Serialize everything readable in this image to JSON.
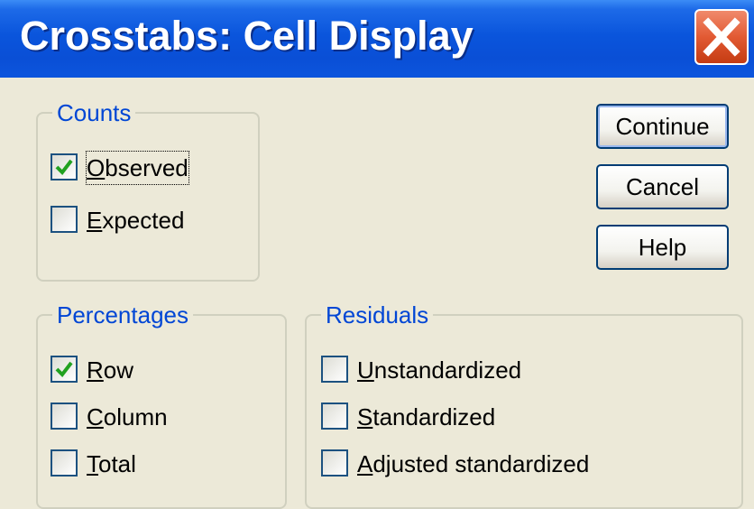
{
  "window": {
    "title": "Crosstabs: Cell Display"
  },
  "counts": {
    "legend": "Counts",
    "items": [
      {
        "label": "Observed",
        "mnemonic": "O",
        "rest": "bserved",
        "checked": true,
        "focused": true
      },
      {
        "label": "Expected",
        "mnemonic": "E",
        "rest": "xpected",
        "checked": false
      }
    ]
  },
  "buttons": {
    "continue": "Continue",
    "cancel": "Cancel",
    "help": "Help"
  },
  "percentages": {
    "legend": "Percentages",
    "items": [
      {
        "label": "Row",
        "mnemonic": "R",
        "rest": "ow",
        "checked": true
      },
      {
        "label": "Column",
        "mnemonic": "C",
        "rest": "olumn",
        "checked": false
      },
      {
        "label": "Total",
        "mnemonic": "T",
        "rest": "otal",
        "checked": false
      }
    ]
  },
  "residuals": {
    "legend": "Residuals",
    "items": [
      {
        "label": "Unstandardized",
        "mnemonic": "U",
        "rest": "nstandardized",
        "checked": false
      },
      {
        "label": "Standardized",
        "mnemonic": "S",
        "rest": "tandardized",
        "checked": false
      },
      {
        "label": "Adjusted standardized",
        "mnemonic": "A",
        "rest": "djusted standardized",
        "checked": false
      }
    ]
  },
  "colors": {
    "titlebar": "#0a55dc",
    "dialog_bg": "#ece9d8",
    "groupbox_legend": "#0046d5",
    "checkmark": "#21a121",
    "close_button": "#e25a33"
  }
}
